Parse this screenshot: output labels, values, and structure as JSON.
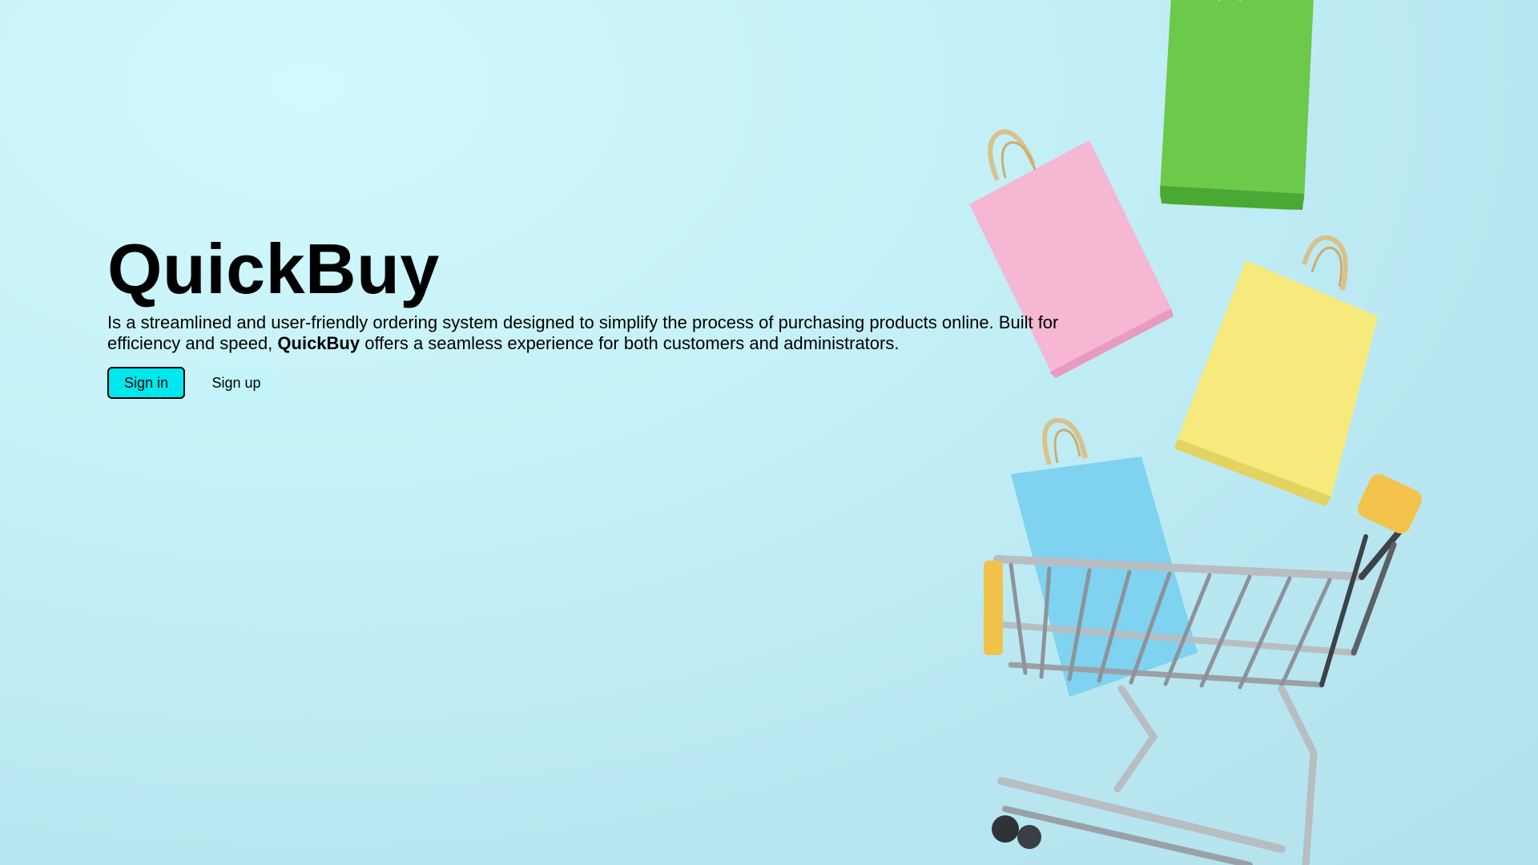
{
  "hero": {
    "title": "QuickBuy",
    "description_part1": "Is a streamlined and user-friendly ordering system designed to simplify the process of purchasing products online. Built for efficiency and speed, ",
    "description_brand": "QuickBuy",
    "description_part2": " offers a seamless experience for both customers and administrators."
  },
  "actions": {
    "signin_label": "Sign in",
    "signup_label": "Sign up"
  },
  "colors": {
    "background": "#c6f1f8",
    "signin_bg": "#00e7ee",
    "signup_bg": "#c3f4fa"
  },
  "hero_image": {
    "subject": "shopping-cart-with-bags",
    "bags": [
      "green",
      "pink",
      "yellow",
      "blue"
    ]
  }
}
